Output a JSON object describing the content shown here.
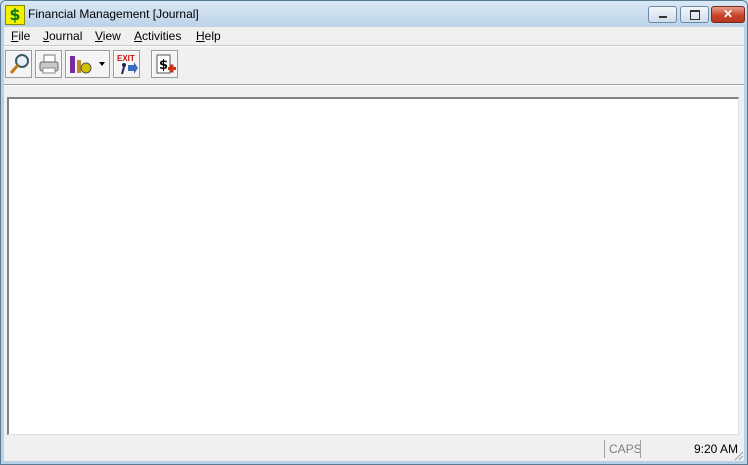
{
  "window": {
    "title": "Financial Management [Journal]",
    "app_icon_glyph": "$",
    "close_glyph": "✕"
  },
  "menu": [
    {
      "label": "File",
      "accel": "F",
      "rest": "ile"
    },
    {
      "label": "Journal",
      "accel": "J",
      "rest": "ournal"
    },
    {
      "label": "View",
      "accel": "V",
      "rest": "iew"
    },
    {
      "label": "Activities",
      "accel": "A",
      "rest": "ctivities"
    },
    {
      "label": "Help",
      "accel": "H",
      "rest": "elp"
    }
  ],
  "toolbar": {
    "buttons": [
      "search-icon",
      "printer-icon",
      "tools-icon",
      "exit-icon",
      "add-journal-icon"
    ],
    "exit_text": "EXIT",
    "journal_glyph": "$"
  },
  "status": {
    "caps": "CAPS",
    "time": "9:20 AM"
  },
  "colors": {
    "titlebar": "#bcd3e8",
    "close_button": "#c7432a",
    "app_icon_bg": "#f6f000"
  }
}
